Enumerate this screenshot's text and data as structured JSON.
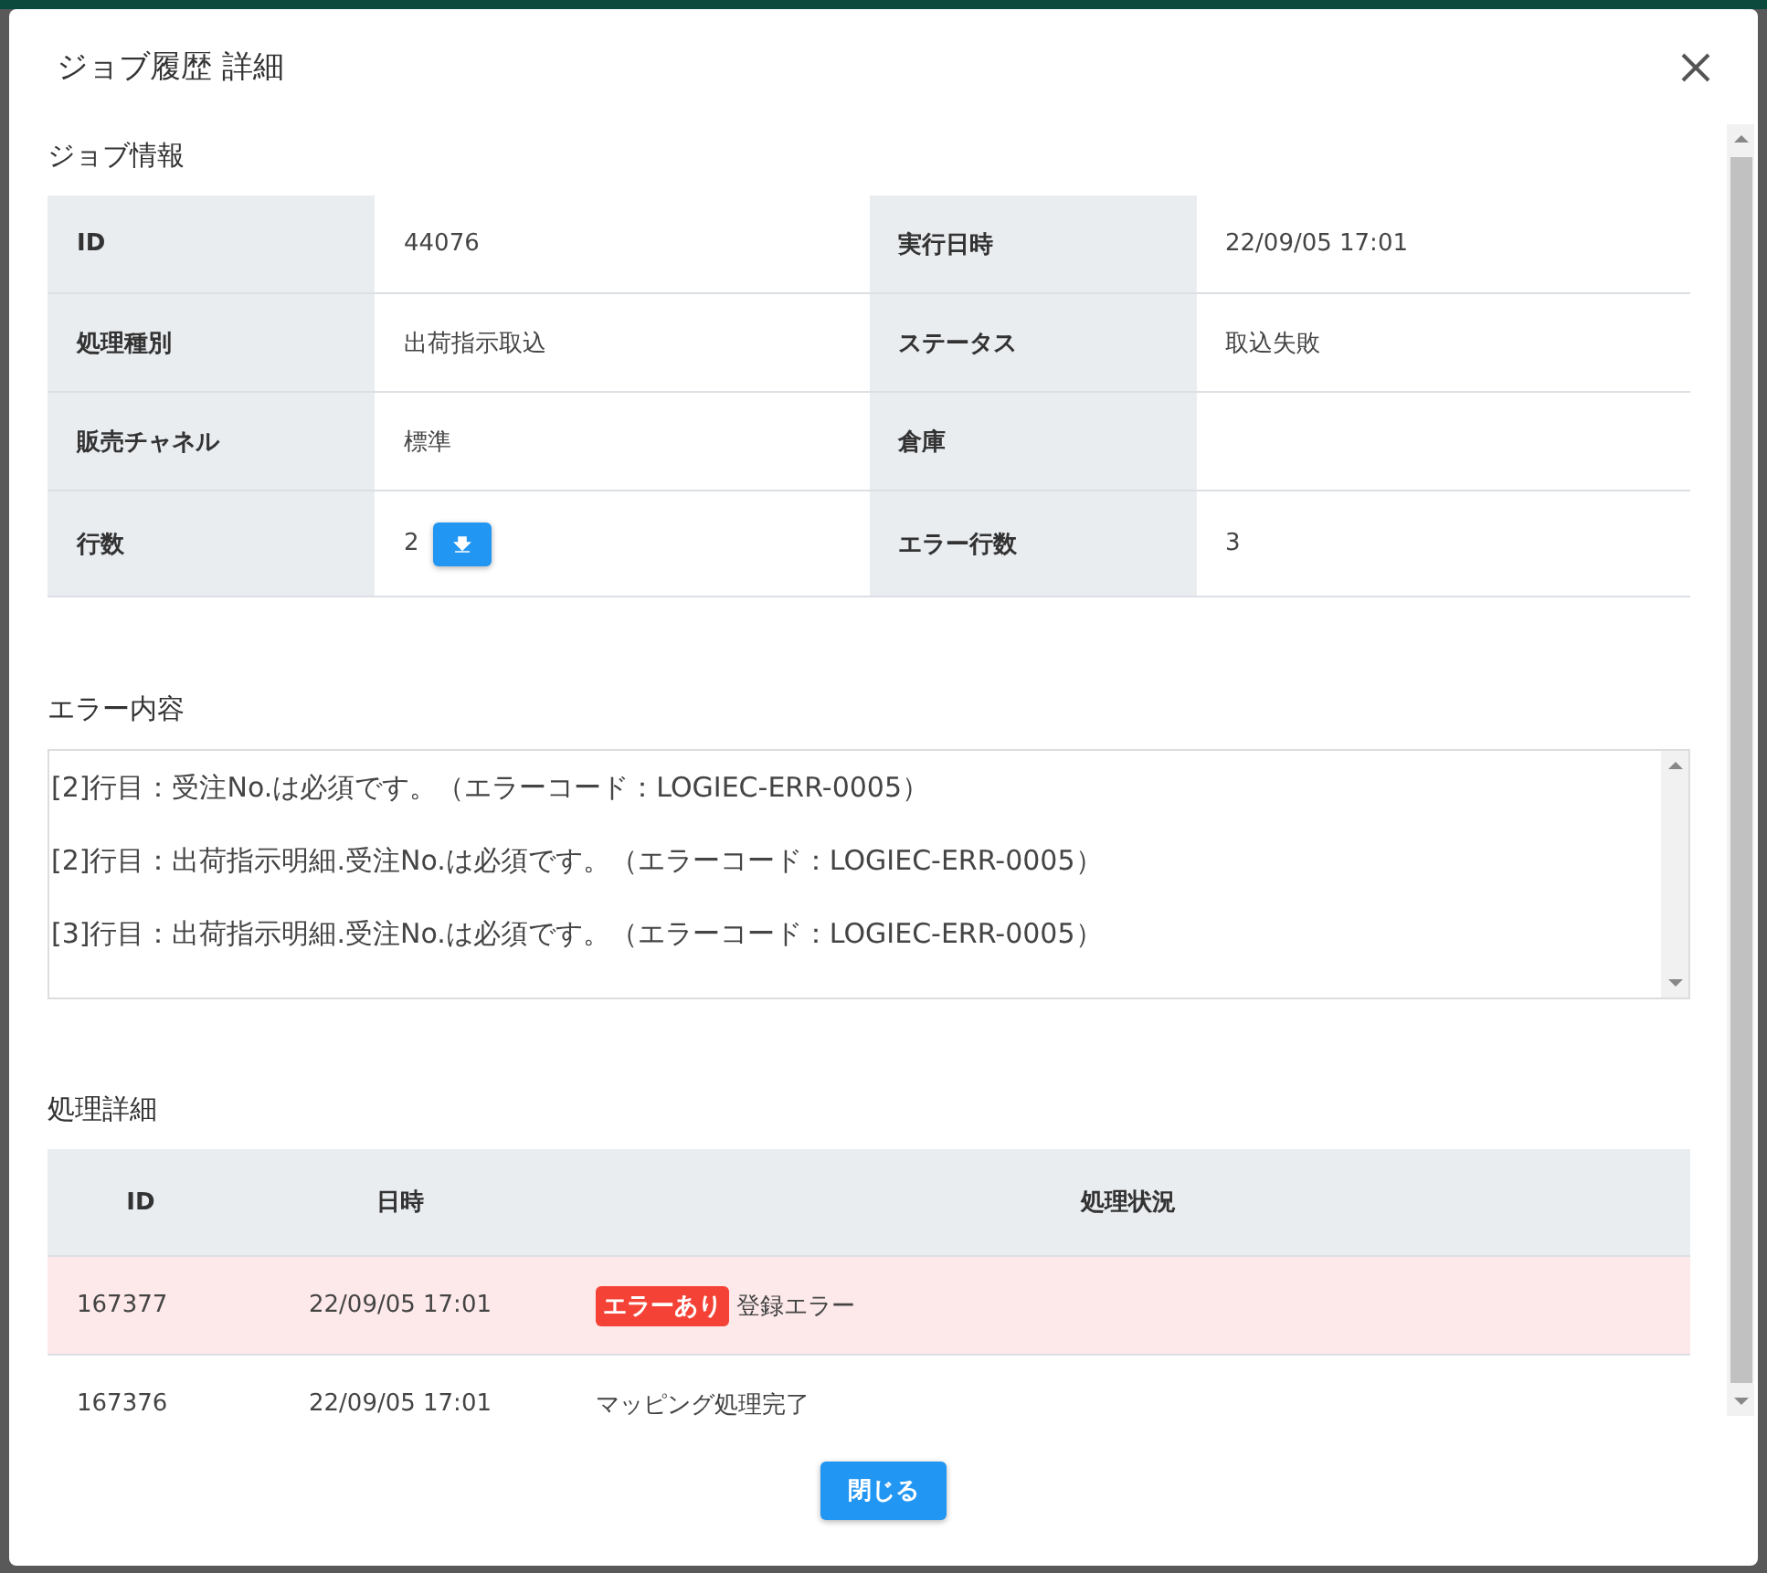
{
  "dialog": {
    "title": "ジョブ履歴 詳細"
  },
  "job_info": {
    "title": "ジョブ情報",
    "rows": [
      {
        "label_1": "ID",
        "value_1": "44076",
        "label_2": "実行日時",
        "value_2": "22/09/05 17:01",
        "download": false
      },
      {
        "label_1": "処理種別",
        "value_1": "出荷指示取込",
        "label_2": "ステータス",
        "value_2": "取込失敗",
        "download": false
      },
      {
        "label_1": "販売チャネル",
        "value_1": "標準",
        "label_2": "倉庫",
        "value_2": "",
        "download": false
      },
      {
        "label_1": "行数",
        "value_1": "2",
        "label_2": "エラー行数",
        "value_2": "3",
        "download": true
      }
    ]
  },
  "errors": {
    "title": "エラー内容",
    "lines": [
      "[2]行目：受注No.は必須です。（エラーコード：LOGIEC-ERR-0005）",
      "[2]行目：出荷指示明細.受注No.は必須です。（エラーコード：LOGIEC-ERR-0005）",
      "[3]行目：出荷指示明細.受注No.は必須です。（エラーコード：LOGIEC-ERR-0005）"
    ]
  },
  "process_details": {
    "title": "処理詳細",
    "columns": [
      "ID",
      "日時",
      "処理状況"
    ],
    "rows": [
      {
        "id": "167377",
        "time": "22/09/05 17:01",
        "badge": "エラーあり",
        "status": "登録エラー",
        "error": true
      },
      {
        "id": "167376",
        "time": "22/09/05 17:01",
        "status": "マッピング処理完了",
        "error": false
      }
    ]
  },
  "buttons": {
    "close": "閉じる"
  }
}
